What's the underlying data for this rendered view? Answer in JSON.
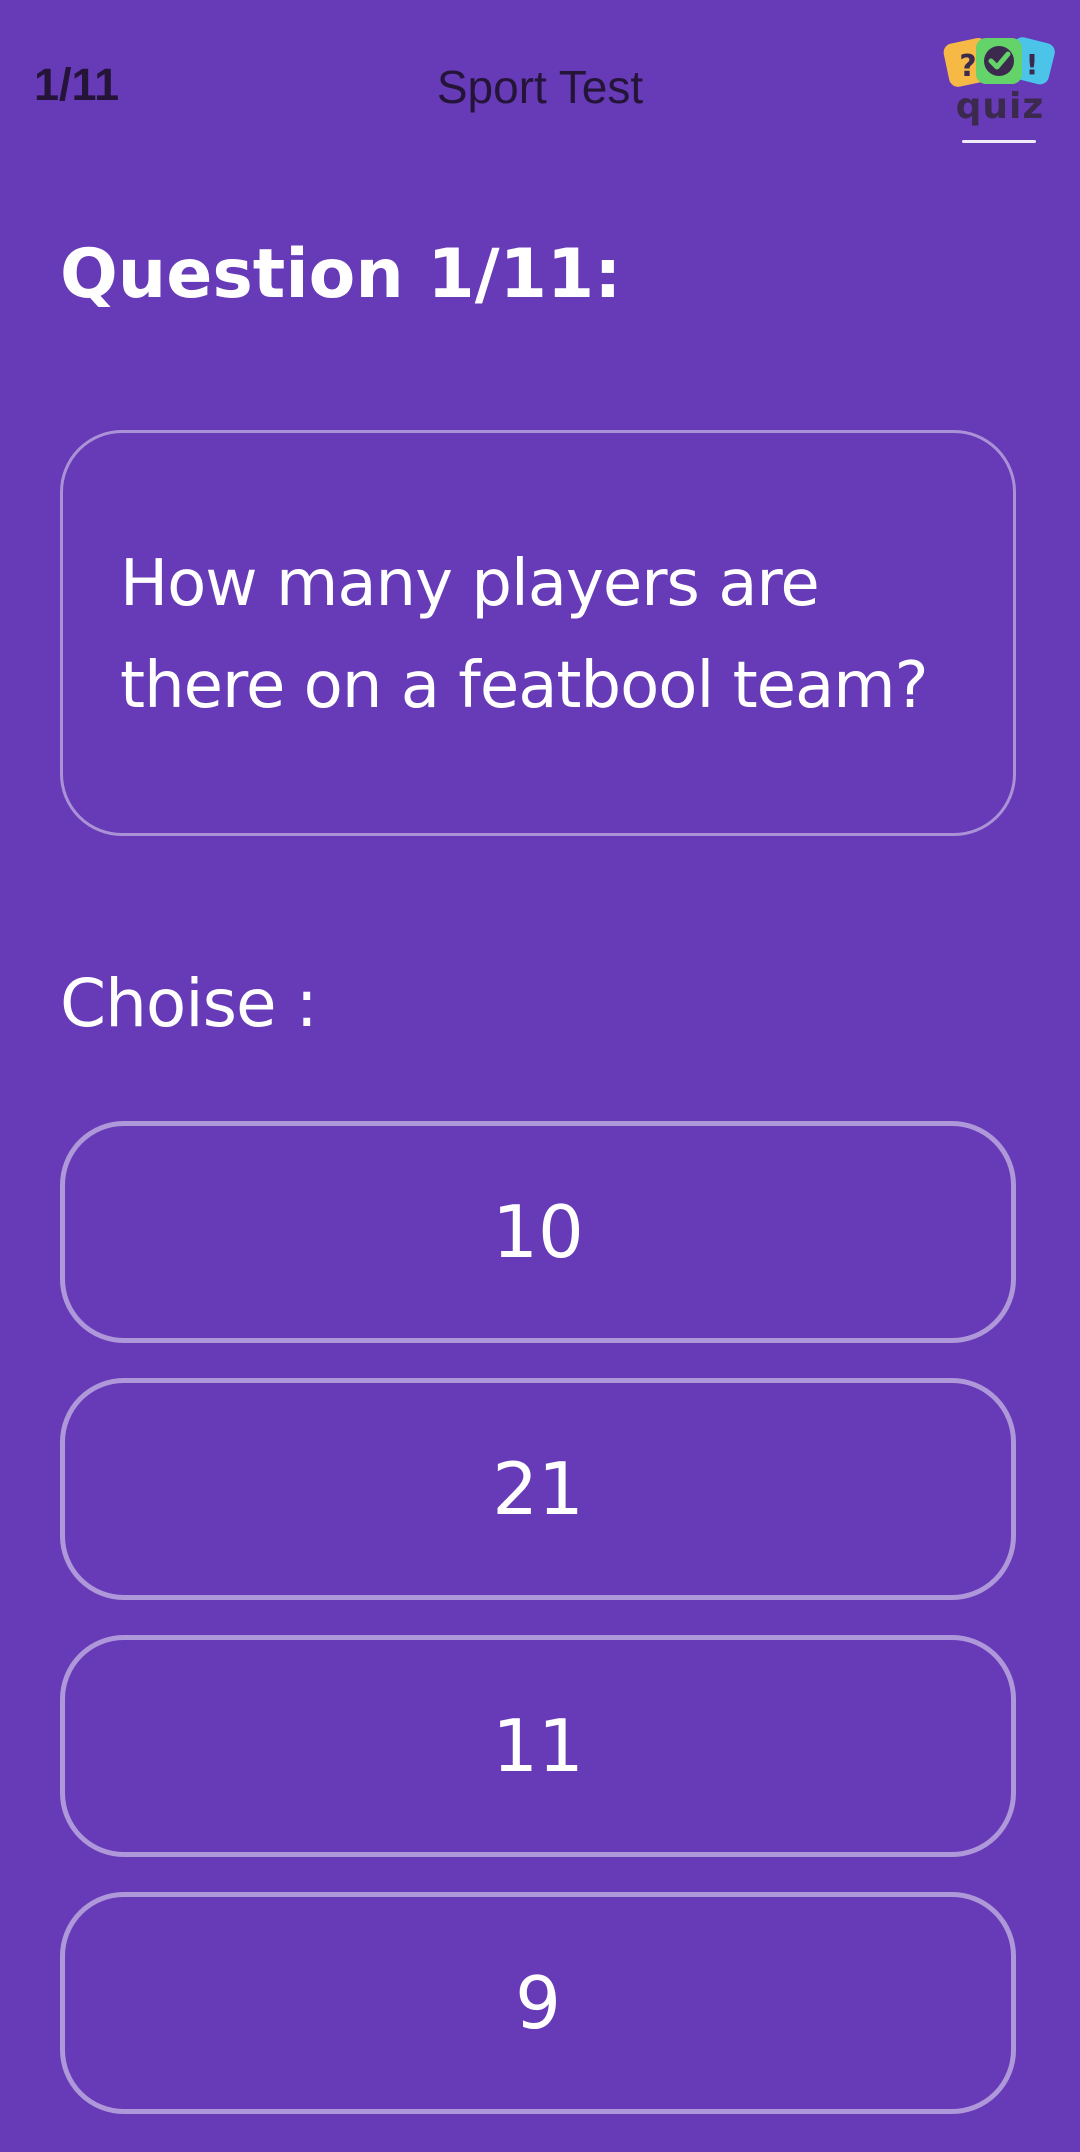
{
  "header": {
    "counter": "1/11",
    "title": "Sport Test",
    "logo": {
      "icon": "quiz-logo-icon",
      "text": "quiz",
      "symbols": [
        "?",
        "✓",
        "!"
      ],
      "colors": [
        "#f6b945",
        "#64d36a",
        "#4cc3e8",
        "#3b2a4e"
      ]
    }
  },
  "question": {
    "heading": "Question 1/11:",
    "text": "How many players are there on a featbool team?"
  },
  "choices_label": "Choise :",
  "choices": [
    {
      "label": "10"
    },
    {
      "label": "21"
    },
    {
      "label": "11"
    },
    {
      "label": "9"
    }
  ],
  "colors": {
    "background": "#673ab7",
    "header_text": "#241538",
    "text": "#ffffff",
    "border": "#b39ddb"
  }
}
